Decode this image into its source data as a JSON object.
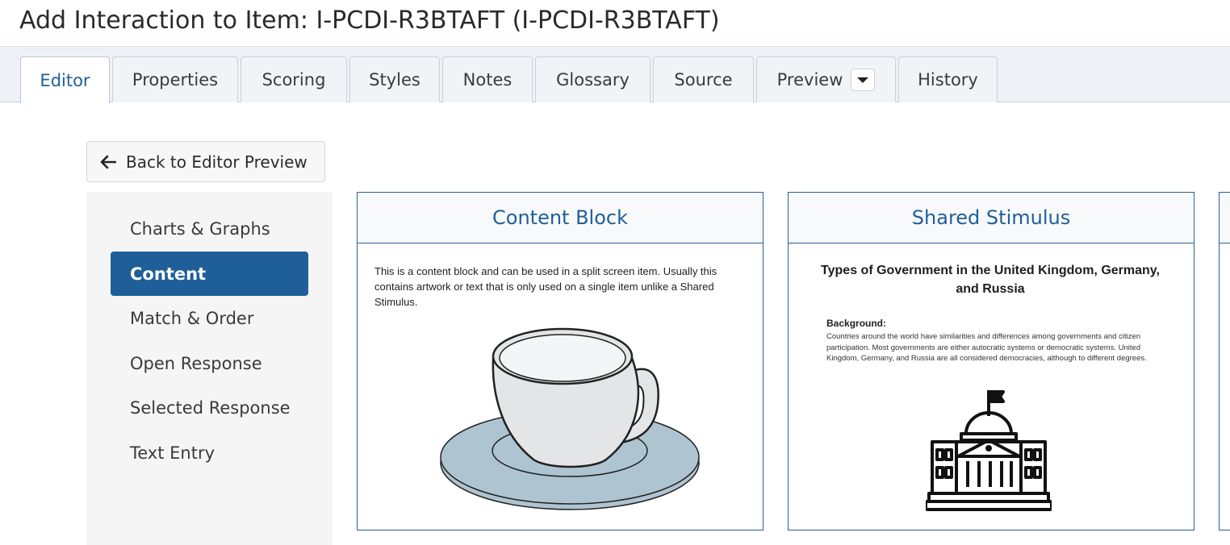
{
  "page": {
    "title": "Add Interaction to Item: I-PCDI-R3BTAFT (I-PCDI-R3BTAFT)"
  },
  "tabs": [
    {
      "label": "Editor",
      "active": true
    },
    {
      "label": "Properties"
    },
    {
      "label": "Scoring"
    },
    {
      "label": "Styles"
    },
    {
      "label": "Notes"
    },
    {
      "label": "Glossary"
    },
    {
      "label": "Source"
    },
    {
      "label": "Preview",
      "has_dropdown": true
    },
    {
      "label": "History"
    }
  ],
  "back_button": {
    "label": "Back to Editor Preview",
    "icon": "arrow-left-icon"
  },
  "sidebar": {
    "items": [
      {
        "label": "Charts & Graphs"
      },
      {
        "label": "Content",
        "active": true
      },
      {
        "label": "Match & Order"
      },
      {
        "label": "Open Response"
      },
      {
        "label": "Selected Response"
      },
      {
        "label": "Text Entry"
      }
    ]
  },
  "cards": {
    "content_block": {
      "title": "Content Block",
      "text": "This is a content block and can be used in a split screen item. Usually this contains artwork or text that is only used on a single item unlike a Shared Stimulus.",
      "image_icon": "teacup-icon"
    },
    "shared_stimulus": {
      "title": "Shared Stimulus",
      "heading": "Types of Government in the United Kingdom, Germany, and Russia",
      "background_label": "Background:",
      "background_text": "Countries around the world have similarities and differences among governments and citizen participation. Most governments are either autocratic systems or democratic systems. United Kingdom, Germany, and Russia are all considered democracies, although to different degrees.",
      "image_icon": "government-building-icon"
    }
  },
  "colors": {
    "accent": "#1f5f99",
    "card_border": "#2b5f95",
    "saucer": "#aec4d1",
    "cup": "#e3e5e7"
  }
}
